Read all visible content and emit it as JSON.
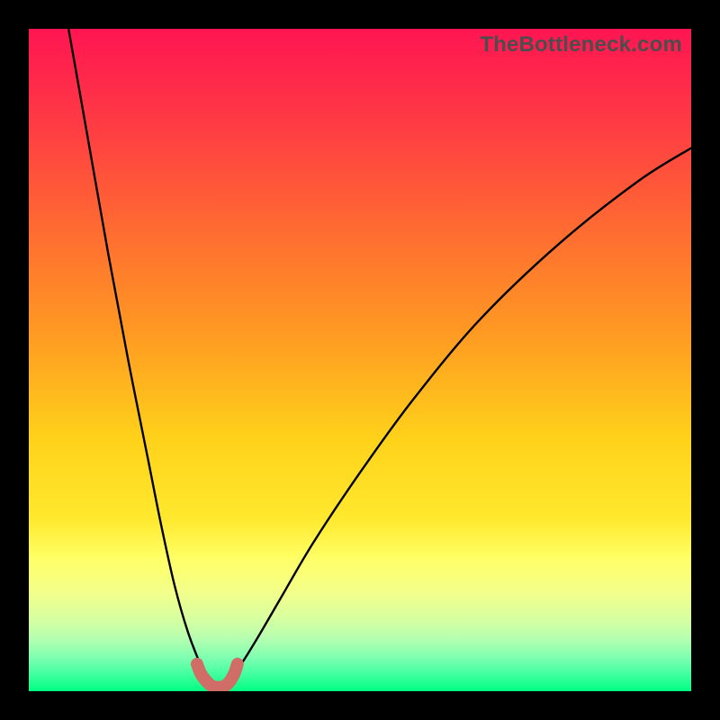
{
  "watermark": "TheBottleneck.com",
  "chart_data": {
    "type": "line",
    "title": "",
    "xlabel": "",
    "ylabel": "",
    "xlim": [
      0,
      100
    ],
    "ylim": [
      0,
      100
    ],
    "series": [
      {
        "name": "left-branch",
        "x": [
          6.0,
          9.0,
          12.0,
          15.0,
          18.0,
          20.0,
          22.0,
          24.0,
          26.0,
          26.8
        ],
        "y": [
          100.0,
          83.0,
          66.0,
          50.0,
          35.0,
          25.0,
          16.0,
          9.0,
          3.8,
          2.3
        ]
      },
      {
        "name": "right-branch",
        "x": [
          30.5,
          32.0,
          34.5,
          38.0,
          43.0,
          50.0,
          58.0,
          68.0,
          80.0,
          92.0,
          100.0
        ],
        "y": [
          2.3,
          4.0,
          8.0,
          14.0,
          22.5,
          33.0,
          44.0,
          56.0,
          67.5,
          77.0,
          82.0
        ]
      },
      {
        "name": "bottom-connector-thick",
        "x": [
          25.4,
          26.0,
          27.0,
          27.8,
          28.6,
          29.4,
          30.2,
          31.0,
          31.5
        ],
        "y": [
          4.1,
          2.6,
          1.3,
          0.7,
          0.6,
          0.7,
          1.3,
          2.6,
          4.1
        ]
      }
    ],
    "annotations": [],
    "legend": false,
    "grid": false,
    "colors": {
      "curve": "#000000",
      "connector": "#cf6d66",
      "gradient_stops": [
        {
          "pos": 0.0,
          "color": "#ff1552"
        },
        {
          "pos": 0.14,
          "color": "#ff3a44"
        },
        {
          "pos": 0.3,
          "color": "#ff6a32"
        },
        {
          "pos": 0.46,
          "color": "#ff9a22"
        },
        {
          "pos": 0.62,
          "color": "#ffd21a"
        },
        {
          "pos": 0.74,
          "color": "#ffe92e"
        },
        {
          "pos": 0.8,
          "color": "#ffff66"
        },
        {
          "pos": 0.85,
          "color": "#f3ff8a"
        },
        {
          "pos": 0.89,
          "color": "#d8ffa0"
        },
        {
          "pos": 0.92,
          "color": "#b6ffb0"
        },
        {
          "pos": 0.95,
          "color": "#7dffb0"
        },
        {
          "pos": 0.975,
          "color": "#40ff9e"
        },
        {
          "pos": 1.0,
          "color": "#00ff84"
        }
      ]
    }
  }
}
